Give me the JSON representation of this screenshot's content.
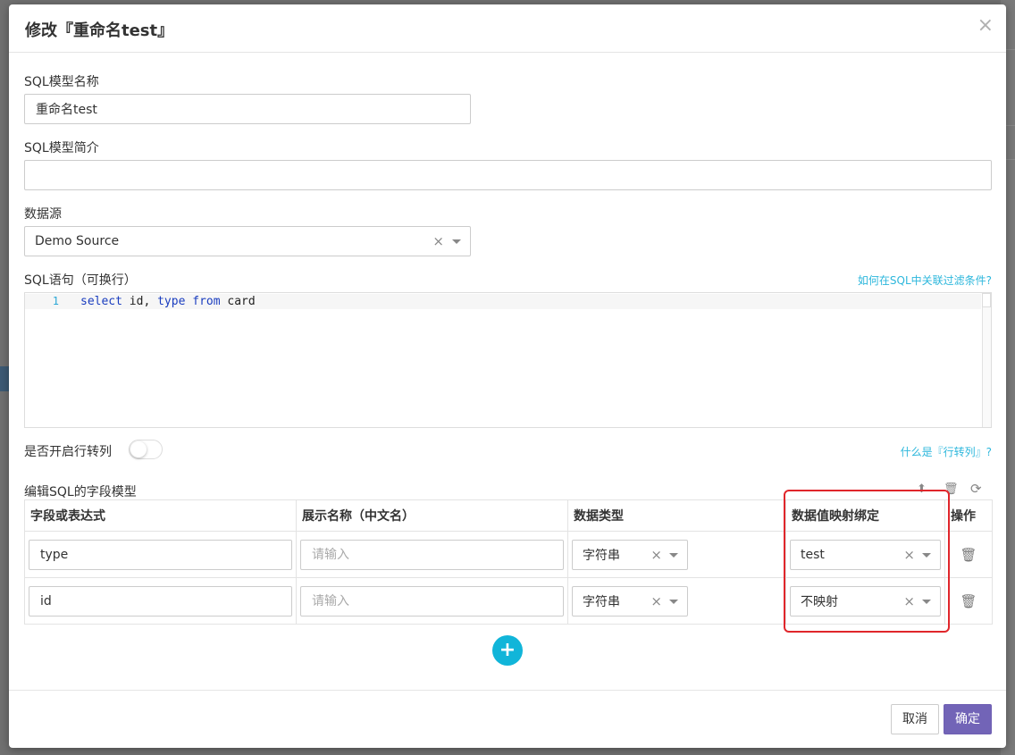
{
  "dialog": {
    "title": "修改『重命名test』",
    "close_symbol": "×"
  },
  "form": {
    "model_name_label": "SQL模型名称",
    "model_name_value": "重命名test",
    "model_desc_label": "SQL模型简介",
    "model_desc_value": "",
    "datasource_label": "数据源",
    "datasource_value": "Demo Source",
    "sql_label": "SQL语句（可换行）",
    "sql_help_link": "如何在SQL中关联过滤条件?",
    "sql_line_number": "1",
    "sql_code": {
      "kw1": "select",
      "t1": " id, ",
      "kw2": "type",
      "t2": " ",
      "kw3": "from",
      "t3": " card"
    },
    "pivot_label": "是否开启行转列",
    "pivot_enabled": false,
    "pivot_help_link": "什么是『行转列』?"
  },
  "fields": {
    "section_title": "编辑SQL的字段模型",
    "toolbar_icons": [
      "sort-icon",
      "trash-icon",
      "refresh-icon"
    ],
    "columns": [
      "字段或表达式",
      "展示名称（中文名）",
      "数据类型",
      "数据值映射绑定",
      "操作"
    ],
    "display_placeholder": "请输入",
    "rows": [
      {
        "expr": "type",
        "display_name": "",
        "data_type": "字符串",
        "mapping": "test"
      },
      {
        "expr": "id",
        "display_name": "",
        "data_type": "字符串",
        "mapping": "不映射"
      }
    ],
    "clear_symbol": "×",
    "add_symbol": "+"
  },
  "footer": {
    "cancel_label": "取消",
    "ok_label": "确定"
  },
  "colors": {
    "link": "#2db7dc",
    "primary_button": "#7264b7",
    "add_button": "#11b5d9",
    "highlight": "#e0262b"
  }
}
